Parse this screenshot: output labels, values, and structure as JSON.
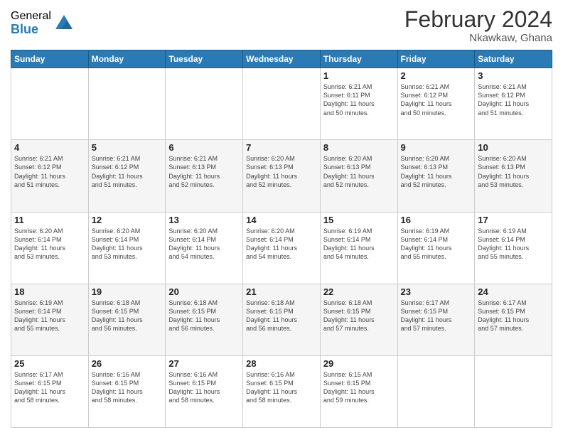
{
  "logo": {
    "general": "General",
    "blue": "Blue"
  },
  "title": "February 2024",
  "subtitle": "Nkawkaw, Ghana",
  "headers": [
    "Sunday",
    "Monday",
    "Tuesday",
    "Wednesday",
    "Thursday",
    "Friday",
    "Saturday"
  ],
  "weeks": [
    [
      {
        "day": "",
        "info": ""
      },
      {
        "day": "",
        "info": ""
      },
      {
        "day": "",
        "info": ""
      },
      {
        "day": "",
        "info": ""
      },
      {
        "day": "1",
        "info": "Sunrise: 6:21 AM\nSunset: 6:11 PM\nDaylight: 11 hours\nand 50 minutes."
      },
      {
        "day": "2",
        "info": "Sunrise: 6:21 AM\nSunset: 6:12 PM\nDaylight: 11 hours\nand 50 minutes."
      },
      {
        "day": "3",
        "info": "Sunrise: 6:21 AM\nSunset: 6:12 PM\nDaylight: 11 hours\nand 51 minutes."
      }
    ],
    [
      {
        "day": "4",
        "info": "Sunrise: 6:21 AM\nSunset: 6:12 PM\nDaylight: 11 hours\nand 51 minutes."
      },
      {
        "day": "5",
        "info": "Sunrise: 6:21 AM\nSunset: 6:12 PM\nDaylight: 11 hours\nand 51 minutes."
      },
      {
        "day": "6",
        "info": "Sunrise: 6:21 AM\nSunset: 6:13 PM\nDaylight: 11 hours\nand 52 minutes."
      },
      {
        "day": "7",
        "info": "Sunrise: 6:20 AM\nSunset: 6:13 PM\nDaylight: 11 hours\nand 52 minutes."
      },
      {
        "day": "8",
        "info": "Sunrise: 6:20 AM\nSunset: 6:13 PM\nDaylight: 11 hours\nand 52 minutes."
      },
      {
        "day": "9",
        "info": "Sunrise: 6:20 AM\nSunset: 6:13 PM\nDaylight: 11 hours\nand 52 minutes."
      },
      {
        "day": "10",
        "info": "Sunrise: 6:20 AM\nSunset: 6:13 PM\nDaylight: 11 hours\nand 53 minutes."
      }
    ],
    [
      {
        "day": "11",
        "info": "Sunrise: 6:20 AM\nSunset: 6:14 PM\nDaylight: 11 hours\nand 53 minutes."
      },
      {
        "day": "12",
        "info": "Sunrise: 6:20 AM\nSunset: 6:14 PM\nDaylight: 11 hours\nand 53 minutes."
      },
      {
        "day": "13",
        "info": "Sunrise: 6:20 AM\nSunset: 6:14 PM\nDaylight: 11 hours\nand 54 minutes."
      },
      {
        "day": "14",
        "info": "Sunrise: 6:20 AM\nSunset: 6:14 PM\nDaylight: 11 hours\nand 54 minutes."
      },
      {
        "day": "15",
        "info": "Sunrise: 6:19 AM\nSunset: 6:14 PM\nDaylight: 11 hours\nand 54 minutes."
      },
      {
        "day": "16",
        "info": "Sunrise: 6:19 AM\nSunset: 6:14 PM\nDaylight: 11 hours\nand 55 minutes."
      },
      {
        "day": "17",
        "info": "Sunrise: 6:19 AM\nSunset: 6:14 PM\nDaylight: 11 hours\nand 55 minutes."
      }
    ],
    [
      {
        "day": "18",
        "info": "Sunrise: 6:19 AM\nSunset: 6:14 PM\nDaylight: 11 hours\nand 55 minutes."
      },
      {
        "day": "19",
        "info": "Sunrise: 6:18 AM\nSunset: 6:15 PM\nDaylight: 11 hours\nand 56 minutes."
      },
      {
        "day": "20",
        "info": "Sunrise: 6:18 AM\nSunset: 6:15 PM\nDaylight: 11 hours\nand 56 minutes."
      },
      {
        "day": "21",
        "info": "Sunrise: 6:18 AM\nSunset: 6:15 PM\nDaylight: 11 hours\nand 56 minutes."
      },
      {
        "day": "22",
        "info": "Sunrise: 6:18 AM\nSunset: 6:15 PM\nDaylight: 11 hours\nand 57 minutes."
      },
      {
        "day": "23",
        "info": "Sunrise: 6:17 AM\nSunset: 6:15 PM\nDaylight: 11 hours\nand 57 minutes."
      },
      {
        "day": "24",
        "info": "Sunrise: 6:17 AM\nSunset: 6:15 PM\nDaylight: 11 hours\nand 57 minutes."
      }
    ],
    [
      {
        "day": "25",
        "info": "Sunrise: 6:17 AM\nSunset: 6:15 PM\nDaylight: 11 hours\nand 58 minutes."
      },
      {
        "day": "26",
        "info": "Sunrise: 6:16 AM\nSunset: 6:15 PM\nDaylight: 11 hours\nand 58 minutes."
      },
      {
        "day": "27",
        "info": "Sunrise: 6:16 AM\nSunset: 6:15 PM\nDaylight: 11 hours\nand 58 minutes."
      },
      {
        "day": "28",
        "info": "Sunrise: 6:16 AM\nSunset: 6:15 PM\nDaylight: 11 hours\nand 58 minutes."
      },
      {
        "day": "29",
        "info": "Sunrise: 6:15 AM\nSunset: 6:15 PM\nDaylight: 11 hours\nand 59 minutes."
      },
      {
        "day": "",
        "info": ""
      },
      {
        "day": "",
        "info": ""
      }
    ]
  ]
}
